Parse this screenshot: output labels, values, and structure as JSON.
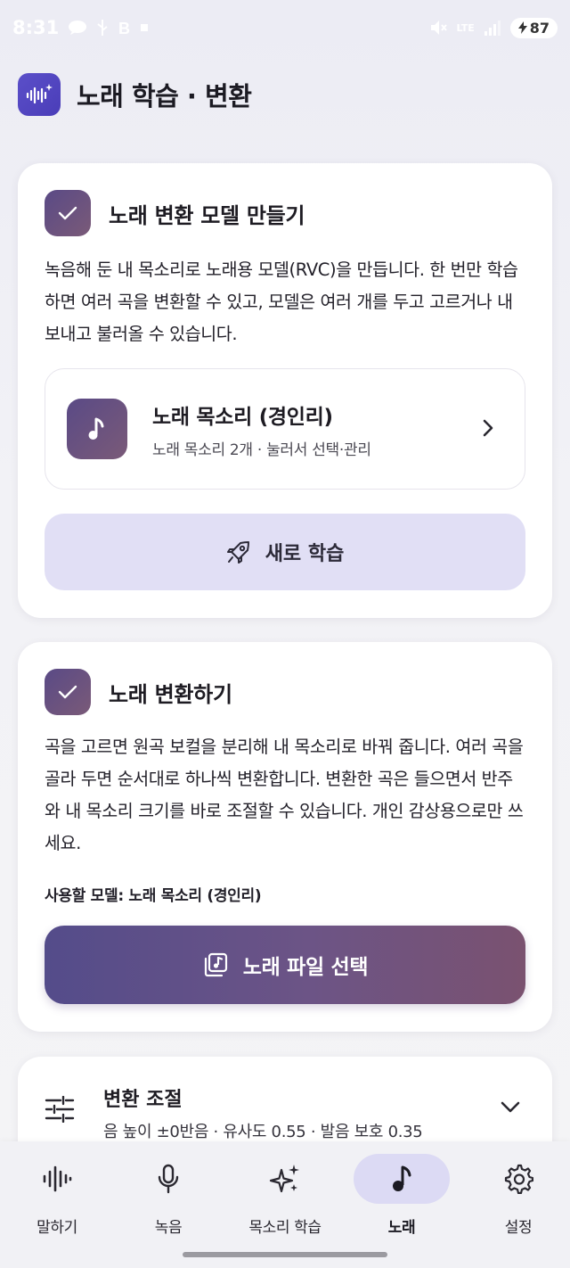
{
  "status_bar": {
    "time": "8:31",
    "network": "LTE",
    "battery": "87",
    "left_icons": [
      "chat-bubble-icon",
      "usb-icon",
      "b-app-icon",
      "dot-icon"
    ],
    "right_icons": [
      "mute-icon",
      "lte-icon",
      "signal-icon",
      "battery-charging-icon"
    ]
  },
  "header": {
    "title": "노래 학습 · 변환",
    "icon": "waveform-sparkle-icon"
  },
  "card_model": {
    "title": "노래 변환 모델 만들기",
    "description": "녹음해 둔 내 목소리로 노래용 모델(RVC)을 만듭니다. 한 번만 학습하면 여러 곡을 변환할 수 있고, 모델은 여러 개를 두고 고르거나 내보내고 불러올 수 있습니다.",
    "selected_model": {
      "name": "노래 목소리 (경인리)",
      "subtitle": "노래 목소리 2개 · 눌러서 선택·관리"
    },
    "train_button": "새로 학습"
  },
  "card_convert": {
    "title": "노래 변환하기",
    "description": "곡을 고르면 원곡 보컬을 분리해 내 목소리로 바꿔 줍니다. 여러 곡을 골라 두면 순서대로 하나씩 변환합니다. 변환한 곡은 들으면서 반주와 내 목소리 크기를 바로 조절할 수 있습니다. 개인 감상용으로만 쓰세요.",
    "model_in_use": "사용할 모델: 노래 목소리 (경인리)",
    "file_button": "노래 파일 선택"
  },
  "card_adjust": {
    "title": "변환 조절",
    "summary": "음 높이 ±0반음 · 유사도 0.55 · 발음 보호 0.35"
  },
  "bottom_nav": {
    "items": [
      {
        "label": "말하기",
        "icon": "waveform-icon"
      },
      {
        "label": "녹음",
        "icon": "microphone-icon"
      },
      {
        "label": "목소리 학습",
        "icon": "sparkles-icon"
      },
      {
        "label": "노래",
        "icon": "music-note-icon"
      },
      {
        "label": "설정",
        "icon": "gear-icon"
      }
    ],
    "active_index": 3
  },
  "colors": {
    "accent_gradient_start": "#544c8a",
    "accent_gradient_end": "#7a5270",
    "secondary_button": "#e1dff5",
    "active_nav_pill": "#dcdaf4"
  }
}
